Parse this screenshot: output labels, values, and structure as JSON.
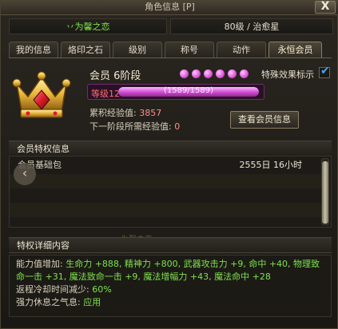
{
  "window": {
    "title": "角色信息 [P]",
    "close_label": "X"
  },
  "header": {
    "character_name": "丷为馨之恋",
    "level_class": "80级 / 治愈星"
  },
  "tabs": [
    {
      "label": "我的信息",
      "active": false
    },
    {
      "label": "烙印之石",
      "active": false
    },
    {
      "label": "级别",
      "active": false
    },
    {
      "label": "称号",
      "active": false
    },
    {
      "label": "动作",
      "active": false
    },
    {
      "label": "永恒会员",
      "active": true
    }
  ],
  "vip": {
    "title": "会员 6阶段",
    "stage_dots": 6,
    "special_effect_label": "特殊效果标示",
    "special_effect_checked": true,
    "level_label": "等级12",
    "level_progress_text": "(1589/1589)",
    "level_progress": 1.0,
    "exp_label": "累积经验值:",
    "exp_value": "3857",
    "next_label": "下一阶段所需经验值:",
    "next_value": "0",
    "view_button": "查看会员信息"
  },
  "privileges": {
    "header": "会员特权信息",
    "items": [
      {
        "name": "会员基础包",
        "time": "2555日 16小时"
      }
    ]
  },
  "details": {
    "header": "特权详细内容",
    "watermark": "为馨之恋",
    "line1_prefix": "能力值增加:",
    "line1_value": "生命力 +888, 精神力 +800, 武器攻击力 +9, 命中 +40, 物理致命一击 +31, 魔法致命一击 +9, 魔法增幅力 +43, 魔法命中 +28",
    "line2_prefix": "返程冷却时间减少:",
    "line2_value": "60%",
    "line3_prefix": "强力休息之气息:",
    "line3_value": "应用"
  },
  "colors": {
    "accent_green": "#7ee24c",
    "level_red": "#ff6e6e",
    "progress_purple": "#d14bd0",
    "exp_red": "#ff8e8e"
  }
}
